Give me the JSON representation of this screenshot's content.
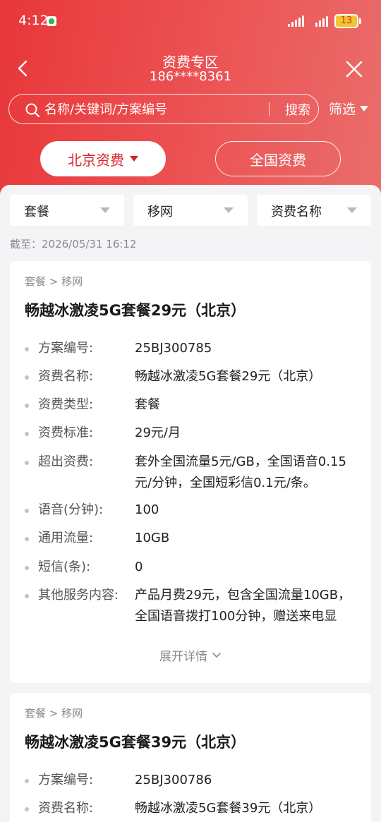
{
  "status": {
    "time": "4:12",
    "battery": "13"
  },
  "nav": {
    "title": "资费专区",
    "phone": "186****8361"
  },
  "search": {
    "placeholder": "名称/关键词/方案编号",
    "button": "搜索",
    "filter": "筛选"
  },
  "tabs": [
    {
      "label": "北京资费"
    },
    {
      "label": "全国资费"
    }
  ],
  "filters": [
    {
      "label": "套餐"
    },
    {
      "label": "移网"
    },
    {
      "label": "资费名称"
    }
  ],
  "deadline": "截至：2026/05/31 16:12",
  "cards": [
    {
      "crumb": "套餐 > 移网",
      "title": "畅越冰激凌5G套餐29元（北京）",
      "fields": [
        {
          "label": "方案编号:",
          "value": "25BJ300785"
        },
        {
          "label": "资费名称:",
          "value": "畅越冰激凌5G套餐29元（北京）"
        },
        {
          "label": "资费类型:",
          "value": "套餐"
        },
        {
          "label": "资费标准:",
          "value": "29元/月"
        },
        {
          "label": "超出资费:",
          "value": "套外全国流量5元/GB，全国语音0.15元/分钟，全国短彩信0.1元/条。"
        },
        {
          "label": "语音(分钟):",
          "value": "100"
        },
        {
          "label": "通用流量:",
          "value": "10GB"
        },
        {
          "label": "短信(条):",
          "value": "0"
        },
        {
          "label": "其他服务内容:",
          "value": "产品月费29元，包含全国流量10GB，全国语音拨打100分钟，赠送来电显"
        }
      ],
      "expand": "展开详情"
    },
    {
      "crumb": "套餐 > 移网",
      "title": "畅越冰激凌5G套餐39元（北京）",
      "fields": [
        {
          "label": "方案编号:",
          "value": "25BJ300786"
        },
        {
          "label": "资费名称:",
          "value": "畅越冰激凌5G套餐39元（北京）"
        }
      ]
    }
  ],
  "colors": {
    "brand_red": "#e8373a",
    "active_tab_text": "#d8262f"
  },
  "icons": [
    "back-icon",
    "close-icon",
    "search-icon",
    "chevron-down-icon",
    "caret-down-icon"
  ]
}
